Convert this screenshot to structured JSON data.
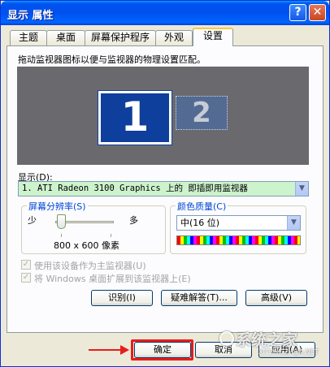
{
  "window": {
    "title": "显示 属性"
  },
  "titlebar": {
    "help_glyph": "?",
    "close_glyph": "✕"
  },
  "tabs": [
    {
      "label": "主题"
    },
    {
      "label": "桌面"
    },
    {
      "label": "屏幕保护程序"
    },
    {
      "label": "外观"
    },
    {
      "label": "设置",
      "active": true
    }
  ],
  "settings": {
    "instruction": "拖动监视器图标以便与监视器的物理设置匹配。",
    "monitors": [
      {
        "number": "1",
        "selected": true
      },
      {
        "number": "2",
        "selected": false
      }
    ],
    "display_label": "显示(D):",
    "display_value": "1. ATI Radeon 3100 Graphics 上的 即插即用监视器",
    "resolution": {
      "title": "屏幕分辨率(S)",
      "min_label": "少",
      "max_label": "多",
      "value": "800 x 600 像素",
      "slider_position": 0.05
    },
    "color": {
      "title": "颜色质量(C)",
      "value": "中(16 位)"
    },
    "primary_checkbox": "使用该设备作为主监视器(U)",
    "extend_checkbox": "将 Windows 桌面扩展到该监视器上(E)",
    "buttons": {
      "identify": "识别(I)",
      "troubleshoot": "疑难解答(T)...",
      "advanced": "高级(V)"
    }
  },
  "footer": {
    "ok": "确定",
    "cancel": "取消",
    "apply": "应用(A)"
  },
  "watermark": {
    "text": "系统之家",
    "sub": "XITONGZHIJIA.NET"
  },
  "colors": {
    "accent_highlight": "#e81c1c",
    "title_bar": "#0053ee",
    "display_bg": "#cdf3cd"
  },
  "dropdown_icon": "▼"
}
